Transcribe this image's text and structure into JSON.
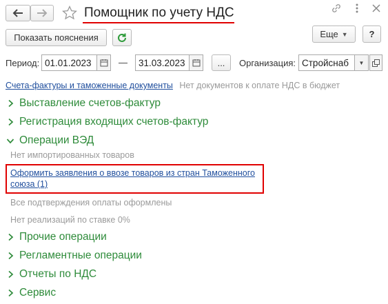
{
  "window": {
    "title": "Помощник по учету НДС"
  },
  "toolbar": {
    "show_explanations_label": "Показать пояснения",
    "more_label": "Еще",
    "help_label": "?"
  },
  "filters": {
    "period_label": "Период:",
    "date_from": "01.01.2023",
    "dash": "—",
    "date_to": "31.03.2023",
    "ellipsis_label": "...",
    "organization_label": "Организация:",
    "organization_value": "Стройснаб"
  },
  "info": {
    "invoices_link": "Счета-фактуры и таможенные документы",
    "no_docs_text": "Нет документов к оплате НДС в бюджет"
  },
  "sections": {
    "issue_invoices": "Выставление счетов-фактур",
    "register_invoices": "Регистрация входящих счетов-фактур",
    "ved": "Операции ВЭД",
    "other": "Прочие операции",
    "regulated": "Регламентные операции",
    "reports": "Отчеты по НДС",
    "service": "Сервис"
  },
  "ved": {
    "no_imported": "Нет импортированных товаров",
    "action_link_line1": "Оформить заявления о ввозе товаров из стран Таможенного",
    "action_link_line2": "союза (1)",
    "all_confirmed": "Все подтверждения оплаты оформлены",
    "no_sales_zero": "Нет реализаций по ставке 0%"
  },
  "colors": {
    "accent_green": "#2e8b3a",
    "link_blue": "#1f4e9d",
    "highlight_red": "#e00000"
  }
}
